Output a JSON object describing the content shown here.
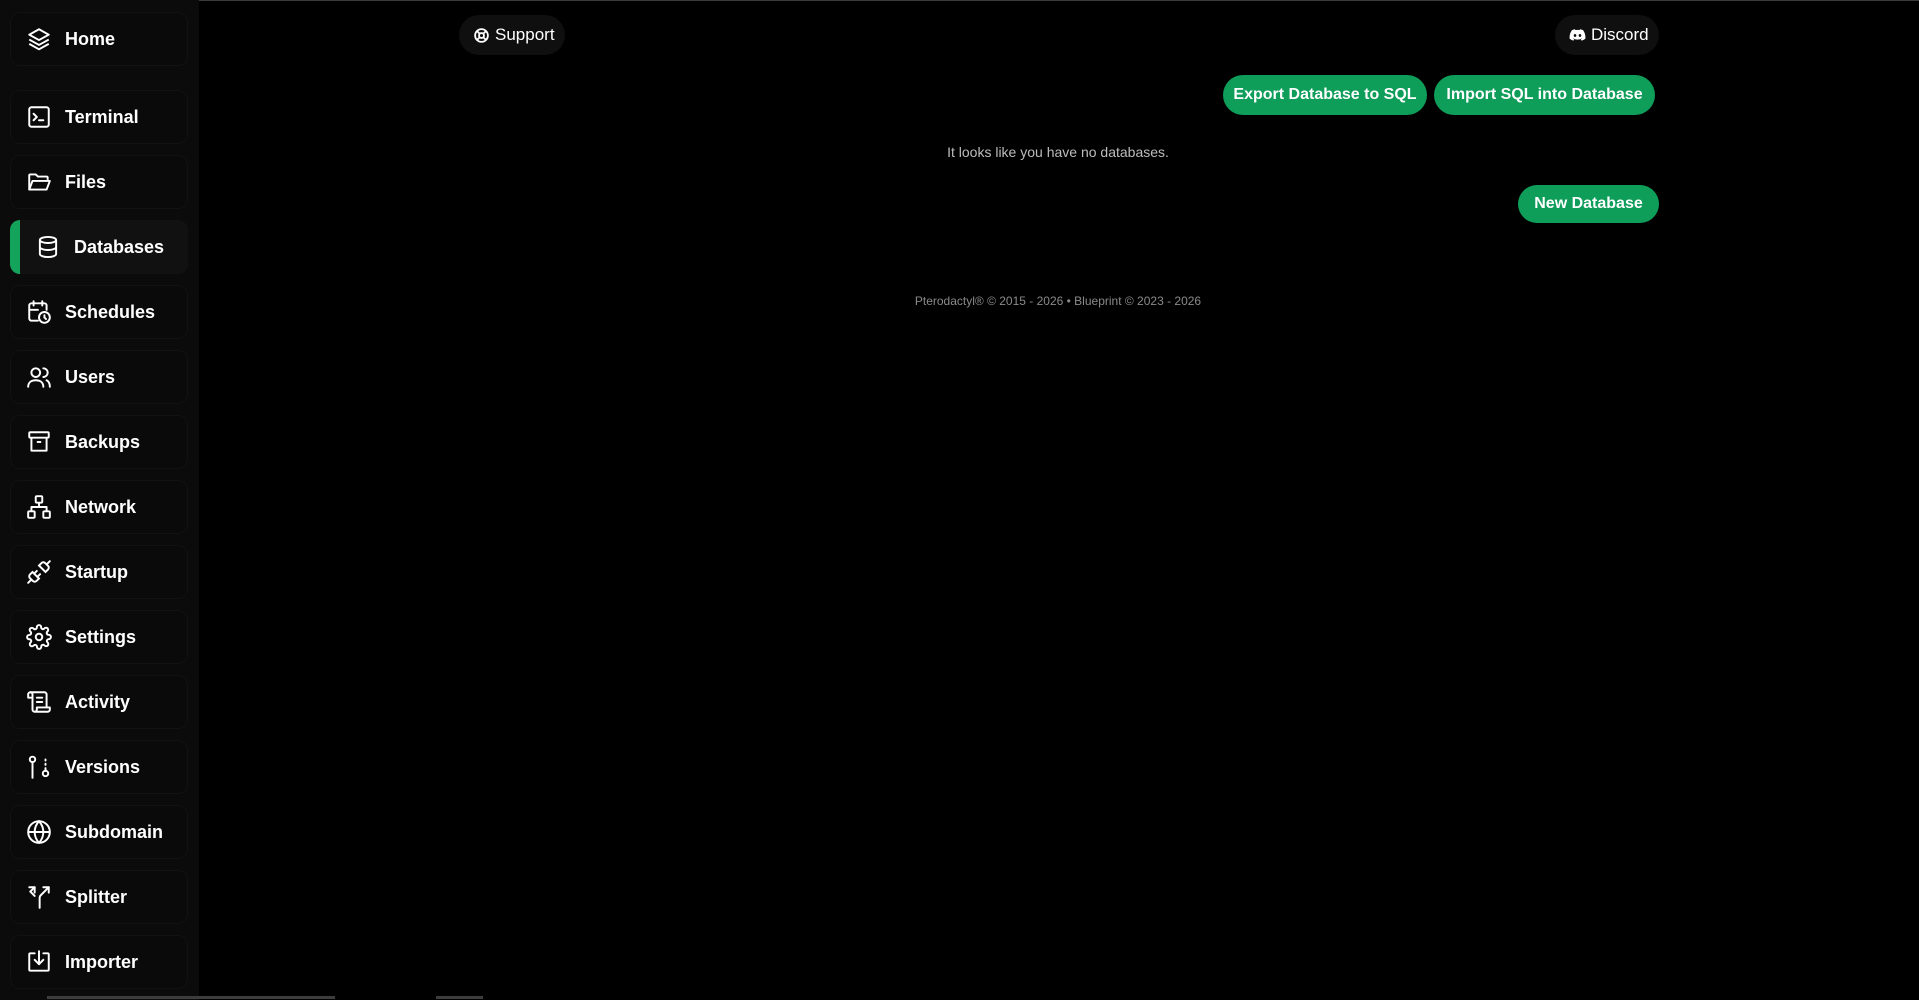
{
  "sidebar": {
    "items": [
      {
        "label": "Home",
        "icon": "layers-icon",
        "name": "sidebar-item-home"
      },
      {
        "label": "Terminal",
        "icon": "terminal-icon",
        "name": "sidebar-item-terminal"
      },
      {
        "label": "Files",
        "icon": "folder-icon",
        "name": "sidebar-item-files"
      },
      {
        "label": "Databases",
        "icon": "database-icon",
        "name": "sidebar-item-databases",
        "active": true
      },
      {
        "label": "Schedules",
        "icon": "calendar-clock-icon",
        "name": "sidebar-item-schedules"
      },
      {
        "label": "Users",
        "icon": "users-icon",
        "name": "sidebar-item-users"
      },
      {
        "label": "Backups",
        "icon": "archive-icon",
        "name": "sidebar-item-backups"
      },
      {
        "label": "Network",
        "icon": "network-icon",
        "name": "sidebar-item-network"
      },
      {
        "label": "Startup",
        "icon": "plug-icon",
        "name": "sidebar-item-startup"
      },
      {
        "label": "Settings",
        "icon": "gear-icon",
        "name": "sidebar-item-settings"
      },
      {
        "label": "Activity",
        "icon": "scroll-icon",
        "name": "sidebar-item-activity"
      },
      {
        "label": "Versions",
        "icon": "git-branch-icon",
        "name": "sidebar-item-versions"
      },
      {
        "label": "Subdomain",
        "icon": "globe-icon",
        "name": "sidebar-item-subdomain"
      },
      {
        "label": "Splitter",
        "icon": "split-icon",
        "name": "sidebar-item-splitter"
      },
      {
        "label": "Importer",
        "icon": "import-icon",
        "name": "sidebar-item-importer"
      }
    ]
  },
  "header": {
    "support_label": "Support",
    "discord_label": "Discord"
  },
  "actions": {
    "export_label": "Export Database to SQL",
    "import_label": "Import SQL into Database",
    "new_database_label": "New Database"
  },
  "main": {
    "empty_message": "It looks like you have no databases."
  },
  "footer": {
    "text": "Pterodactyl® © 2015 - 2026  •  Blueprint © 2023 - 2026"
  },
  "colors": {
    "accent": "#0f9d5a",
    "active_marker": "#14a35b",
    "background": "#000000"
  }
}
